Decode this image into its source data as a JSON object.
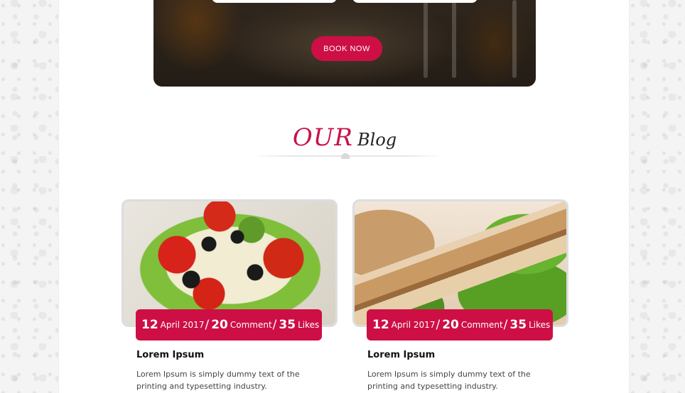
{
  "hero": {
    "book_button": "BOOK NOW"
  },
  "section": {
    "title_accent": "OUR",
    "title_main": "Blog"
  },
  "posts": [
    {
      "day": "12",
      "month_year": "April 2017",
      "comments": "20",
      "comments_label": "Comment",
      "likes": "35",
      "likes_label": "Likes",
      "title": "Lorem Ipsum",
      "excerpt": "Lorem Ipsum is simply dummy text of the printing and typesetting industry.",
      "image": "salad-photo"
    },
    {
      "day": "12",
      "month_year": "April 2017",
      "comments": "20",
      "comments_label": "Comment",
      "likes": "35",
      "likes_label": "Likes",
      "title": "Lorem Ipsum",
      "excerpt": "Lorem Ipsum is simply dummy text of the printing and typesetting industry.",
      "image": "grilled-chicken-photo"
    }
  ],
  "colors": {
    "accent": "#cd0f45",
    "heading_dark": "#222222",
    "background": "#ffffff"
  }
}
